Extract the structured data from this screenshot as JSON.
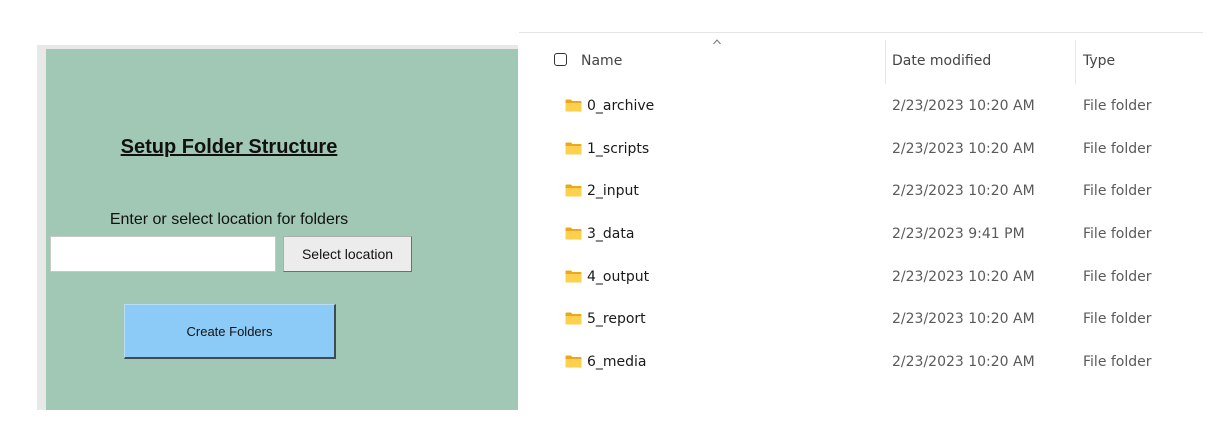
{
  "form": {
    "title": "Setup Folder Structure",
    "location_label": "Enter or select location for folders",
    "location_value": "",
    "select_button": "Select location",
    "create_button": "Create Folders",
    "colors": {
      "panel": "#a0c8b4",
      "create_button": "#8ccbf7"
    }
  },
  "explorer": {
    "columns": {
      "name": "Name",
      "date": "Date modified",
      "type": "Type"
    },
    "sort_icon": "caret-up-icon",
    "item_icon": "folder-icon",
    "rows": [
      {
        "name": "0_archive",
        "date": "2/23/2023 10:20 AM",
        "type": "File folder"
      },
      {
        "name": "1_scripts",
        "date": "2/23/2023 10:20 AM",
        "type": "File folder"
      },
      {
        "name": "2_input",
        "date": "2/23/2023 10:20 AM",
        "type": "File folder"
      },
      {
        "name": "3_data",
        "date": "2/23/2023 9:41 PM",
        "type": "File folder"
      },
      {
        "name": "4_output",
        "date": "2/23/2023 10:20 AM",
        "type": "File folder"
      },
      {
        "name": "5_report",
        "date": "2/23/2023 10:20 AM",
        "type": "File folder"
      },
      {
        "name": "6_media",
        "date": "2/23/2023 10:20 AM",
        "type": "File folder"
      }
    ]
  }
}
